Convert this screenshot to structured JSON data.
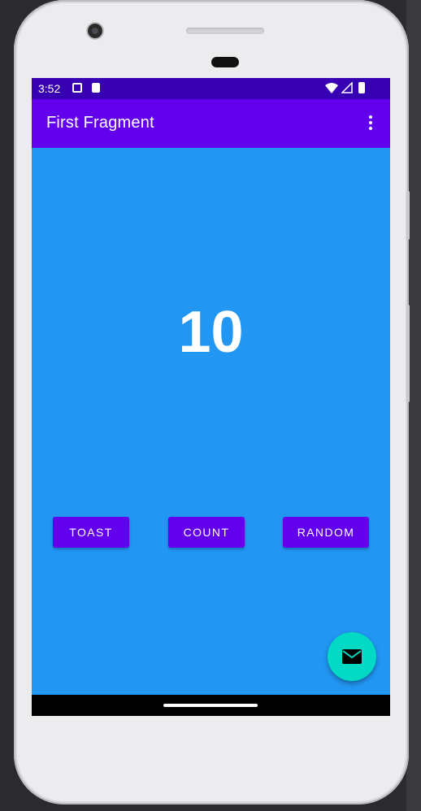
{
  "status_bar": {
    "time": "3:52"
  },
  "app_bar": {
    "title": "First Fragment"
  },
  "main": {
    "count": "10"
  },
  "buttons": {
    "toast": "TOAST",
    "count": "COUNT",
    "random": "RANDOM"
  },
  "colors": {
    "status_bar": "#3700b3",
    "app_bar": "#6200ee",
    "content_background": "#2196f3",
    "button": "#6200ee",
    "fab": "#03dac5"
  },
  "icons": {
    "fab": "mail-icon",
    "overflow": "more-vert-icon"
  }
}
